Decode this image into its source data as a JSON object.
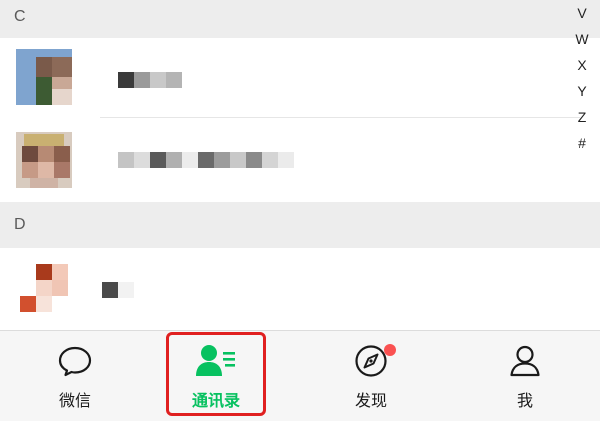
{
  "sections": [
    {
      "letter": "C"
    },
    {
      "letter": "D"
    }
  ],
  "index_letters": [
    "V",
    "W",
    "X",
    "Y",
    "Z",
    "#"
  ],
  "tabs": [
    {
      "label": "微信",
      "icon": "chat-bubble-icon",
      "active": false
    },
    {
      "label": "通讯录",
      "icon": "contacts-icon",
      "active": true
    },
    {
      "label": "发现",
      "icon": "compass-icon",
      "active": false,
      "badge": true
    },
    {
      "label": "我",
      "icon": "profile-icon",
      "active": false
    }
  ],
  "colors": {
    "active_green": "#07c160",
    "highlight_red": "#e02020",
    "badge_red": "#fa5151",
    "section_bg": "#ededed"
  }
}
